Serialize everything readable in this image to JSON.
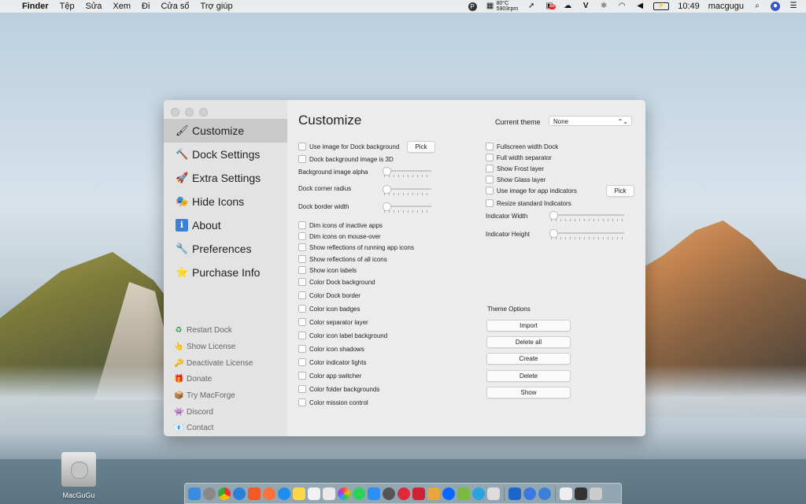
{
  "menubar": {
    "apple": "",
    "items": [
      "Finder",
      "Tệp",
      "Sửa",
      "Xem",
      "Đi",
      "Cửa sổ",
      "Trợ giúp"
    ],
    "temp": "80°C",
    "rpm": "5903rpm",
    "badge": "68",
    "time": "10:49",
    "user": "macgugu"
  },
  "window": {
    "sidebar": {
      "nav": [
        {
          "icon": "🖌",
          "label": "Customize"
        },
        {
          "icon": "🔨",
          "label": "Dock Settings"
        },
        {
          "icon": "🚀",
          "label": "Extra Settings"
        },
        {
          "icon": "🎭",
          "label": "Hide Icons"
        },
        {
          "icon": "ℹ",
          "label": "About"
        },
        {
          "icon": "🔧",
          "label": "Preferences"
        },
        {
          "icon": "⭐",
          "label": "Purchase Info"
        }
      ],
      "sub": [
        {
          "icon": "♻",
          "label": "Restart Dock"
        },
        {
          "icon": "👆",
          "label": "Show License"
        },
        {
          "icon": "🔑",
          "label": "Deactivate License"
        },
        {
          "icon": "🎁",
          "label": "Donate"
        },
        {
          "icon": "📦",
          "label": "Try MacForge"
        },
        {
          "icon": "👾",
          "label": "Discord"
        },
        {
          "icon": "📧",
          "label": "Contact"
        }
      ]
    },
    "main": {
      "title": "Customize",
      "theme_label": "Current theme",
      "theme_value": "None",
      "left": {
        "use_image": "Use image for Dock background",
        "pick": "Pick",
        "image_3d": "Dock background image is 3D",
        "alpha": "Background image alpha",
        "radius": "Dock corner radius",
        "border_width": "Dock border width",
        "checks": [
          "Dim icons of inactive apps",
          "Dim icons on mouse-over",
          "Show reflections of running app icons",
          "Show reflections of all icons",
          "Show icon labels",
          "Color Dock background",
          "Color Dock border",
          "Color icon badges",
          "Color separator layer",
          "Color icon label background",
          "Color icon shadows",
          "Color indicator lights",
          "Color app switcher",
          "Color folder backgrounds",
          "Color mission control"
        ]
      },
      "right": {
        "checks": [
          "Fullscreen width Dock",
          "Full width separator",
          "Show Frost layer",
          "Show Glass layer",
          "Use image for app indicators",
          "Resize standard Indicators"
        ],
        "pick": "Pick",
        "indicator_width": "Indicator Width",
        "indicator_height": "Indicator Height",
        "theme_options": "Theme Options",
        "buttons": [
          "Import",
          "Delete all",
          "Create",
          "Delete",
          "Show"
        ]
      }
    }
  },
  "desktop": {
    "drive_label": "MacGuGu"
  }
}
